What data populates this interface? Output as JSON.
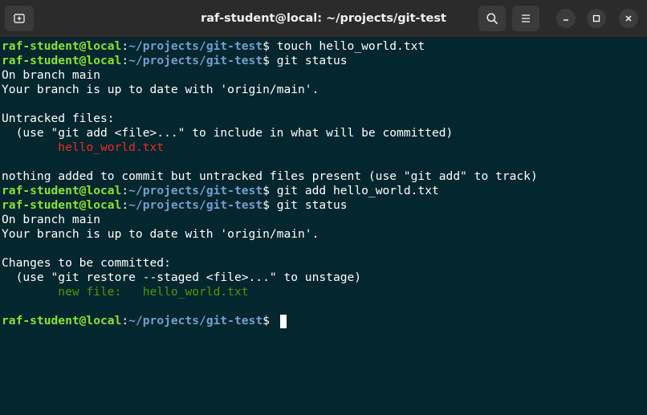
{
  "window": {
    "title": "raf-student@local: ~/projects/git-test"
  },
  "titlebar": {
    "new_tab_icon": "new-tab-icon",
    "search_icon": "search-icon",
    "menu_icon": "hamburger-menu-icon",
    "minimize_icon": "minimize-icon",
    "maximize_icon": "maximize-icon",
    "close_icon": "close-icon"
  },
  "prompt": {
    "user_host": "raf-student@local",
    "sep": ":",
    "path": "~/projects/git-test",
    "symbol": "$ "
  },
  "lines": {
    "l1_cmd": "touch hello_world.txt",
    "l2_cmd": "git status",
    "l3": "On branch main",
    "l4": "Your branch is up to date with 'origin/main'.",
    "l6": "Untracked files:",
    "l7": "  (use \"git add <file>...\" to include in what will be committed)",
    "l8_indent": "        ",
    "l8_file": "hello_world.txt",
    "l10": "nothing added to commit but untracked files present (use \"git add\" to track)",
    "l11_cmd": "git add hello_world.txt",
    "l12_cmd": "git status",
    "l13": "On branch main",
    "l14": "Your branch is up to date with 'origin/main'.",
    "l16": "Changes to be committed:",
    "l17": "  (use \"git restore --staged <file>...\" to unstage)",
    "l18_indent": "        ",
    "l18_text": "new file:   hello_world.txt"
  },
  "colors": {
    "background": "#04262e",
    "user_host": "#8ae234",
    "path": "#729fcf",
    "untracked": "#ef2929",
    "staged": "#4e9a06"
  }
}
